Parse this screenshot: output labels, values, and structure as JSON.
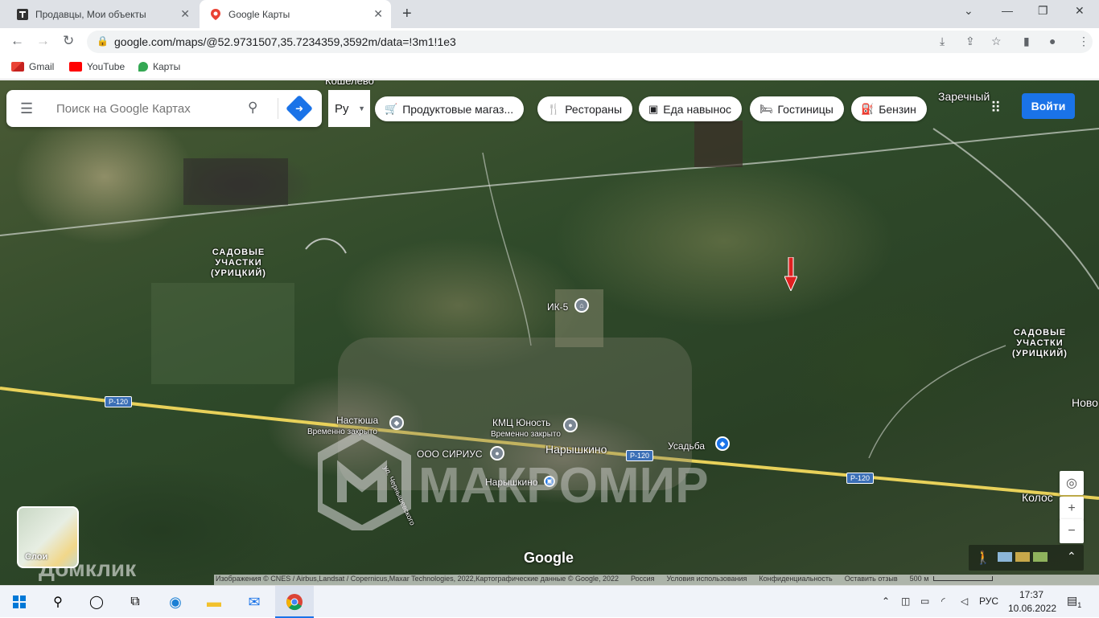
{
  "browser": {
    "tabs": [
      {
        "title": "Продавцы, Мои объекты",
        "active": false
      },
      {
        "title": "Google Карты",
        "active": true
      }
    ],
    "url": "google.com/maps/@52.9731507,35.7234359,3592m/data=!3m1!1e3",
    "bookmarks": [
      {
        "label": "Gmail",
        "icon": "gmail-icon"
      },
      {
        "label": "YouTube",
        "icon": "youtube-icon"
      },
      {
        "label": "Карты",
        "icon": "maps-icon"
      }
    ]
  },
  "maps": {
    "search_placeholder": "Поиск на Google Картах",
    "language": "Ру",
    "chips": [
      {
        "label": "Продуктовые магаз...",
        "icon": "cart-icon"
      },
      {
        "label": "Рестораны",
        "icon": "fork-knife-icon"
      },
      {
        "label": "Еда навынос",
        "icon": "takeout-icon"
      },
      {
        "label": "Гостиницы",
        "icon": "bed-icon"
      },
      {
        "label": "Бензин",
        "icon": "fuel-icon"
      }
    ],
    "login_label": "Войти",
    "layers_label": "Слои",
    "map_labels": {
      "gardens_left": "САДОВЫЕ\nУЧАСТКИ\n(УРИЦКИЙ)",
      "gardens_right": "САДОВЫЕ\nУЧАСТКИ\n(УРИЦКИЙ)",
      "zarechny": "Заречный",
      "koshelevo": "Кошелёво",
      "ik5": "ИК-5",
      "nastyusha": "Настюша",
      "nastyusha_status": "Временно закрыто",
      "kmc": "КМЦ Юность",
      "kmc_status": "Временно закрыто",
      "sirius": "ООО СИРИУС",
      "naryshkino_town": "Нарышкино",
      "naryshkino_station": "Нарышкино",
      "usadba": "Усадьба",
      "street": "ул. Чернышевского",
      "novo": "Ново",
      "kolos": "Колос",
      "road_shields": [
        "Р-120",
        "Р-120",
        "Р-120"
      ]
    },
    "google_logo": "Google",
    "attribution": [
      "Изображения © CNES / Airbus,Landsat / Copernicus,Maxar Technologies, 2022,Картографические данные © Google, 2022",
      "Россия",
      "Условия использования",
      "Конфиденциальность",
      "Оставить отзыв",
      "500 м"
    ],
    "watermark_text": "МАКРОМИР",
    "domclick_text": "Домклик"
  },
  "taskbar": {
    "language": "РУС",
    "time": "17:37",
    "date": "10.06.2022",
    "notification_count": "1"
  },
  "colors": {
    "accent_blue": "#1a73e8",
    "road_yellow": "#e8d15a"
  }
}
